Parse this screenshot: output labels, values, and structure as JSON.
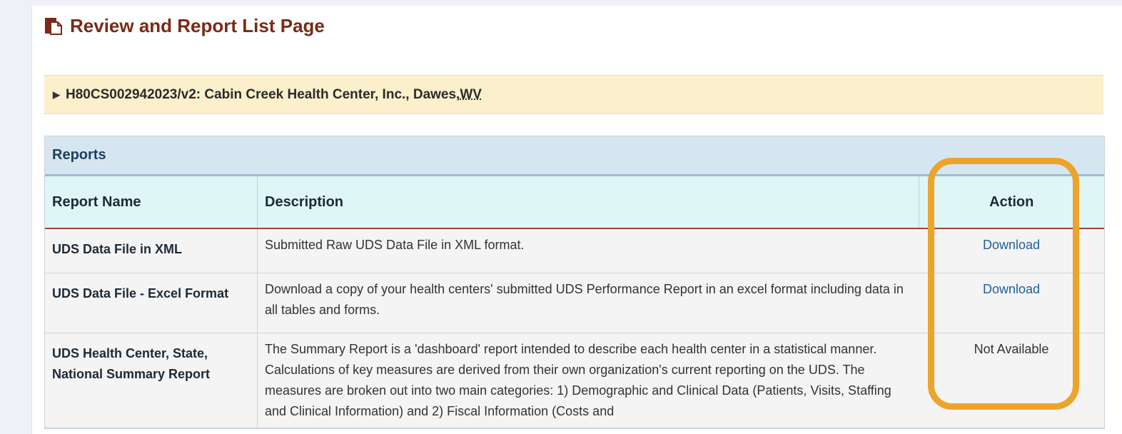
{
  "page": {
    "title": "Review and Report List Page"
  },
  "org": {
    "grant": "H80CS002942023/v2: Cabin Creek Health Center, Inc., Dawes, ",
    "state": "WV"
  },
  "reports": {
    "heading": "Reports",
    "columns": {
      "name": "Report Name",
      "description": "Description",
      "action": "Action"
    },
    "rows": [
      {
        "name": "UDS Data File in XML",
        "description": "Submitted Raw UDS Data File in XML format.",
        "action": "Download"
      },
      {
        "name": "UDS Data File - Excel Format",
        "description": "Download a copy of your health centers' submitted UDS Performance Report in an excel format including data in all tables and forms.",
        "action": "Download"
      },
      {
        "name": "UDS Health Center, State, National Summary Report",
        "description": "The Summary Report is a 'dashboard' report intended to describe each health center in a statistical manner. Calculations of key measures are derived from their own organization's current reporting on the UDS. The measures are broken out into two main categories: 1) Demographic and Clinical Data (Patients, Visits, Staffing and Clinical Information) and 2) Fiscal Information (Costs and",
        "action": "Not Available"
      }
    ]
  },
  "colors": {
    "title": "#7a2a16",
    "highlight": "#eba42c",
    "link": "#1f5f9c"
  }
}
